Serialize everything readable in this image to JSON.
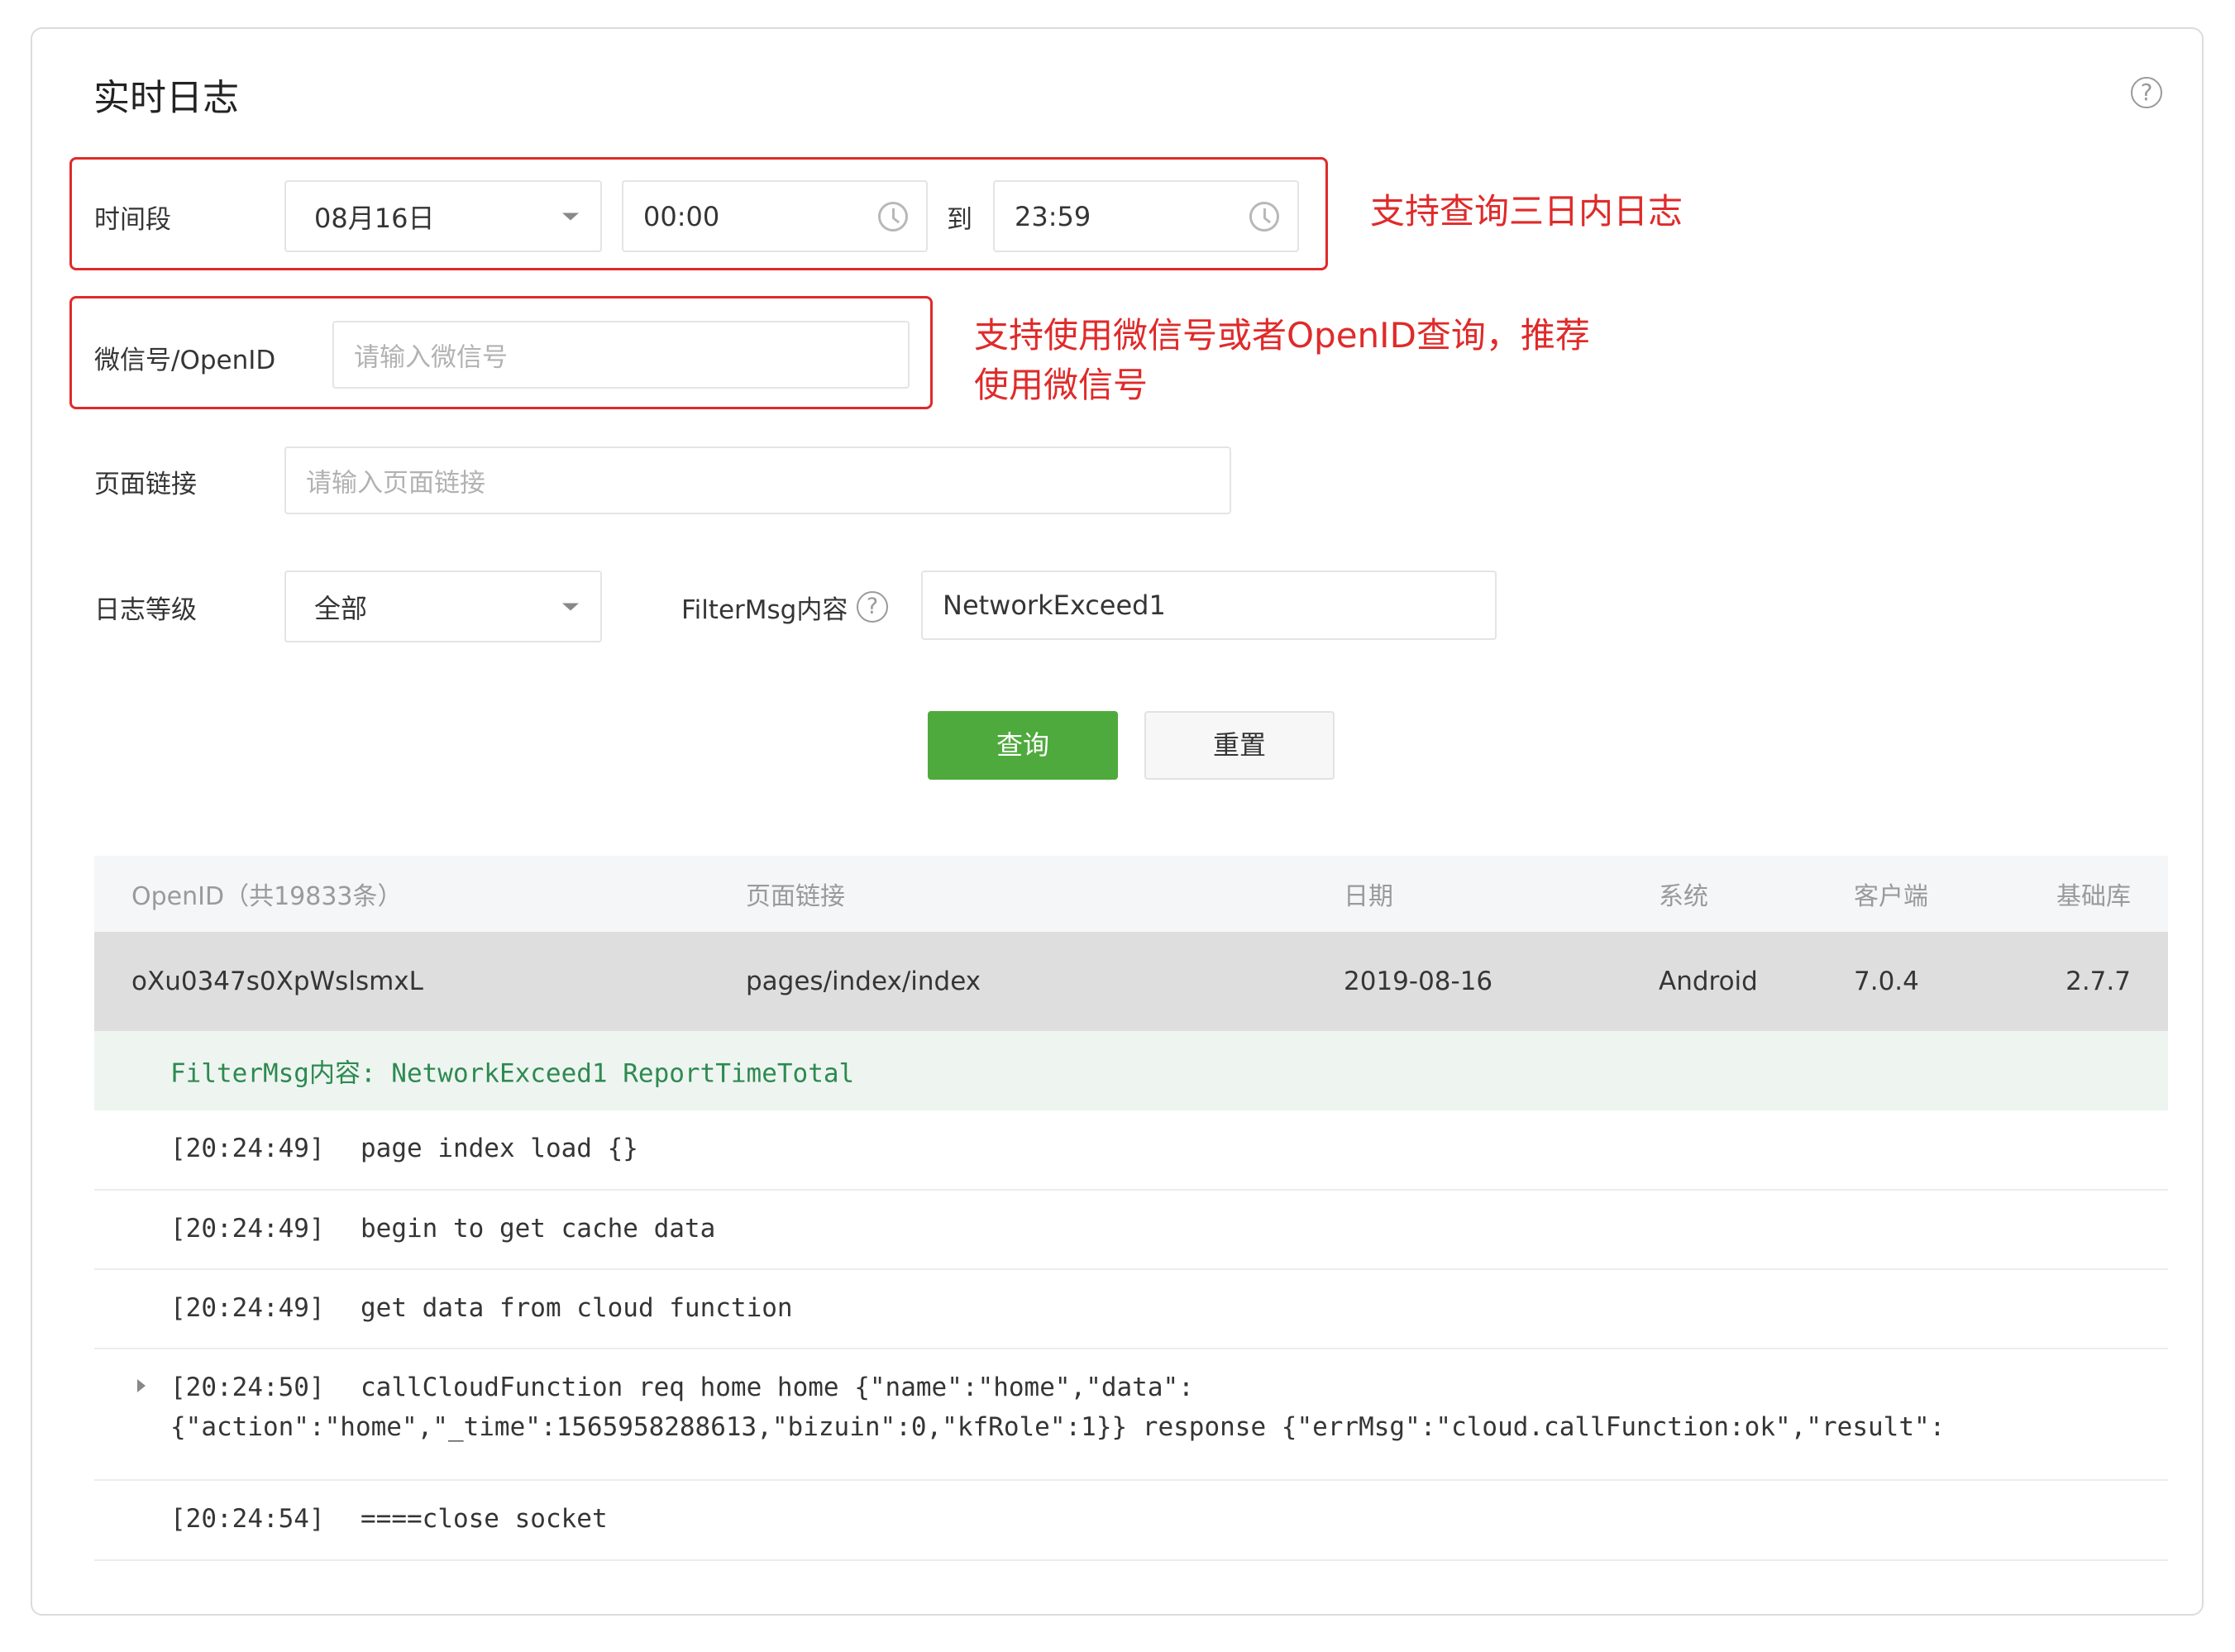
{
  "page": {
    "title": "实时日志",
    "help_symbol": "?"
  },
  "form": {
    "time_range": {
      "label": "时间段",
      "date": "08月16日",
      "start_time": "00:00",
      "to_label": "到",
      "end_time": "23:59"
    },
    "wechat_id": {
      "label": "微信号/OpenID",
      "placeholder": "请输入微信号",
      "value": ""
    },
    "page_link": {
      "label": "页面链接",
      "placeholder": "请输入页面链接",
      "value": ""
    },
    "log_level": {
      "label": "日志等级",
      "selected": "全部"
    },
    "filter_msg": {
      "label": "FilterMsg内容",
      "help_symbol": "?",
      "value": "NetworkExceed1"
    },
    "buttons": {
      "query": "查询",
      "reset": "重置"
    }
  },
  "annotations": {
    "time_note": "支持查询三日内日志",
    "id_note_line1": "支持使用微信号或者OpenID查询，推荐",
    "id_note_line2": "使用微信号",
    "color": "#e02a2a"
  },
  "table": {
    "headers": {
      "openid": "OpenID（共19833条）",
      "page_link": "页面链接",
      "date": "日期",
      "system": "系统",
      "client": "客户端",
      "base_lib": "基础库"
    },
    "row": {
      "openid": "oXu0347s0XpWslsmxL",
      "page_link": "pages/index/index",
      "date": "2019-08-16",
      "system": "Android",
      "client": "7.0.4",
      "base_lib": "2.7.7"
    },
    "filter_line": "FilterMsg内容: NetworkExceed1 ReportTimeTotal",
    "logs": [
      {
        "time": "[20:24:49]",
        "msg": "page index load {}"
      },
      {
        "time": "[20:24:49]",
        "msg": "begin to get cache data"
      },
      {
        "time": "[20:24:49]",
        "msg": "get data from cloud function"
      },
      {
        "time": "[20:24:50]",
        "msg": "callCloudFunction req home home {\"name\":\"home\",\"data\":",
        "msg_cont": "{\"action\":\"home\",\"_time\":1565958288613,\"bizuin\":0,\"kfRole\":1}} response {\"errMsg\":\"cloud.callFunction:ok\",\"result\":",
        "expandable": true
      },
      {
        "time": "[20:24:54]",
        "msg": "====close socket"
      }
    ]
  },
  "colors": {
    "primary_green": "#4eaa3c",
    "annotation_red": "#e02a2a",
    "filter_green": "#2e8a50"
  }
}
